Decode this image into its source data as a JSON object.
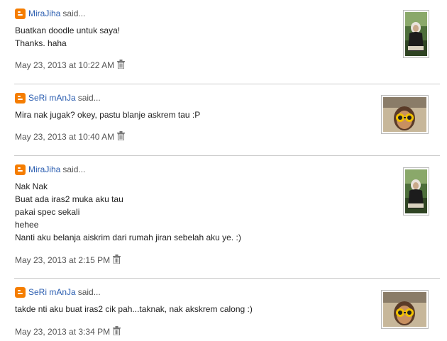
{
  "said_label": "said...",
  "comments": [
    {
      "author": "MiraJiha",
      "lines": [
        "Buatkan doodle untuk saya!",
        "Thanks. haha"
      ],
      "timestamp": "May 23, 2013 at 10:22 AM",
      "avatar": "mira-avatar"
    },
    {
      "author": "SeRi mAnJa",
      "lines": [
        "Mira nak jugak? okey, pastu blanje askrem tau :P"
      ],
      "timestamp": "May 23, 2013 at 10:40 AM",
      "avatar": "seri-avatar"
    },
    {
      "author": "MiraJiha",
      "lines": [
        "Nak Nak",
        "Buat ada iras2 muka aku tau",
        "pakai spec sekali",
        "hehee",
        "Nanti aku belanja aiskrim dari rumah jiran sebelah aku ye. :)"
      ],
      "timestamp": "May 23, 2013 at 2:15 PM",
      "avatar": "mira-avatar"
    },
    {
      "author": "SeRi mAnJa",
      "lines": [
        "takde nti aku buat iras2 cik pah...taknak, nak akskrem calong :)"
      ],
      "timestamp": "May 23, 2013 at 3:34 PM",
      "avatar": "seri-avatar"
    }
  ],
  "colors": {
    "author_link": "#2a5db0",
    "blogger_orange": "#f57d00",
    "divider": "#cccccc"
  }
}
